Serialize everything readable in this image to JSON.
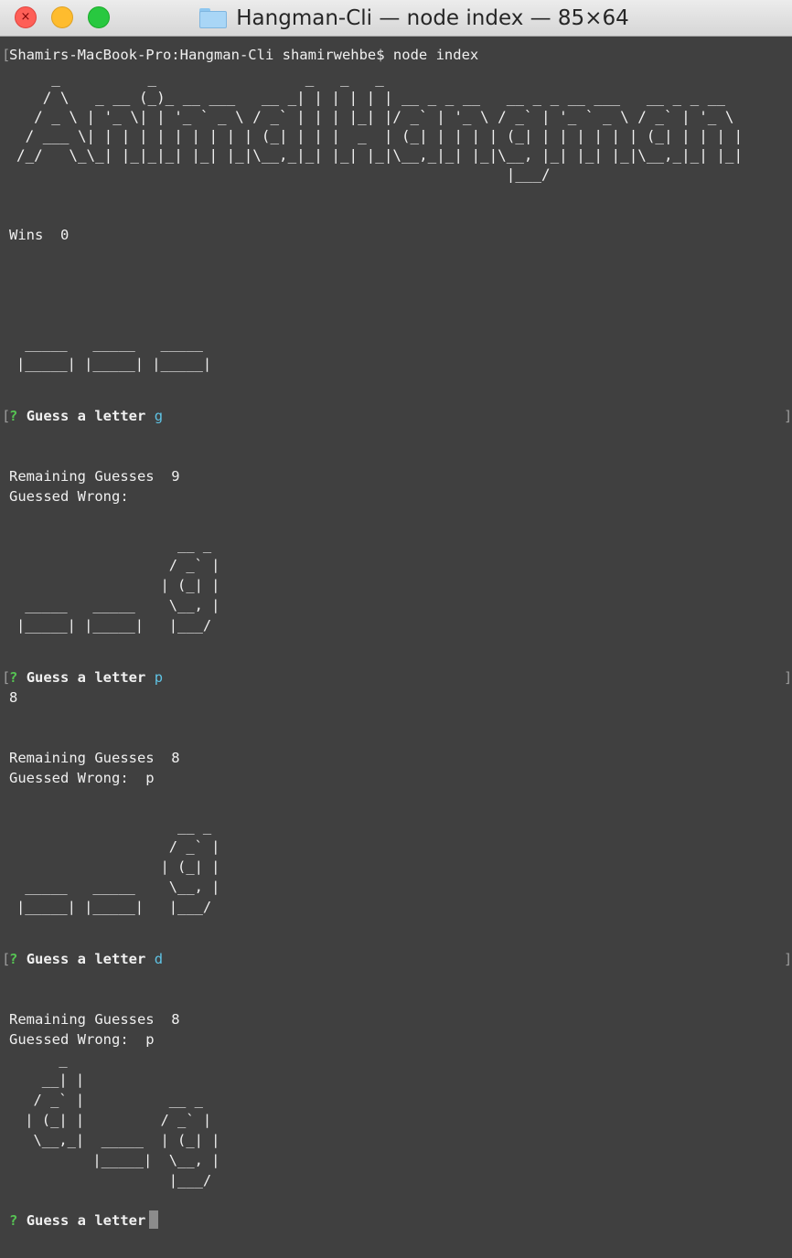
{
  "window": {
    "title": "Hangman-Cli — node index — 85×64",
    "close_glyph": "×"
  },
  "terminal": {
    "prompt_command": "Shamirs-MacBook-Pro:Hangman-Cli shamirwehbe$ node index",
    "banner_art": "    _          _                 _   _   _\n   / \\   _ __ (_)_ __ ___   __ _| | | | | | __ _ _ __   __ _ _ __ ___   __ _ _ __\n  / _ \\ | '_ \\| | '_ ` _ \\ / _` | | | |_| |/ _` | '_ \\ / _` | '_ ` _ \\ / _` | '_ \\\n / ___ \\| | | | | | | | | | (_| | | |  _  | (_| | | | | (_| | | | | | | (_| | | | |\n/_/   \\_\\_| |_|_|_| |_| |_|\\__,_|_| |_| |_|\\__,_|_| |_|\\__, |_| |_| |_|\\__,_|_| |_|\n                                                        |___/",
    "wins_label": "Wins  0",
    "blanks_art": " _____   _____   _____\n|_____| |_____| |_____|",
    "rounds": [
      {
        "question_mark": "?",
        "prompt": "Guess a letter",
        "answer": "g",
        "extra_line": "",
        "remaining": "Remaining Guesses  9",
        "wrong": "Guessed Wrong:",
        "word_art": "                   __ _\n                  / _` |\n                 | (_| |\n _____   _____    \\__, |\n|_____| |_____|   |___/"
      },
      {
        "question_mark": "?",
        "prompt": "Guess a letter",
        "answer": "p",
        "extra_line": "8",
        "remaining": "Remaining Guesses  8",
        "wrong": "Guessed Wrong:  p",
        "word_art": "                   __ _\n                  / _` |\n                 | (_| |\n _____   _____    \\__, |\n|_____| |_____|   |___/"
      },
      {
        "question_mark": "?",
        "prompt": "Guess a letter",
        "answer": "d",
        "extra_line": "",
        "remaining": "Remaining Guesses  8",
        "wrong": "Guessed Wrong:  p",
        "word_art": "     _\n   __| |\n  / _` |          __ _\n | (_| |         / _` |\n  \\__,_|  _____  | (_| |\n         |_____|  \\__, |\n                  |___/"
      }
    ],
    "current_prompt": {
      "question_mark": "?",
      "prompt": "Guess a letter"
    }
  },
  "colors": {
    "background": "#404040",
    "text": "#f0f0f0",
    "question_mark": "#56c353",
    "answer": "#5fc3e4"
  }
}
